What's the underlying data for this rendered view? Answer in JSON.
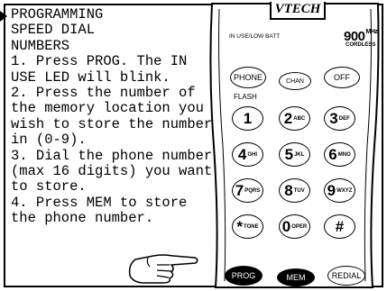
{
  "instructions": {
    "lines": [
      "PROGRAMMING",
      "SPEED DIAL",
      "NUMBERS",
      "1. Press PROG. The IN",
      "USE LED will blink.",
      "2. Press the number of",
      "the memory location you",
      "wish to store the number",
      "in (0-9).",
      "3. Dial the phone number",
      "(max 16 digits) you want",
      "to store.",
      "4. Press MEM to store",
      "the phone number."
    ]
  },
  "phone": {
    "brand": "VTECH",
    "in_use_label": "IN USE/LOW BATT",
    "frequency": "900",
    "frequency_unit": "MHz",
    "cordless": "CORDLESS",
    "flash_label": "FLASH",
    "buttons": {
      "phone": "PHONE",
      "chan": "CHAN",
      "off": "OFF",
      "prog": "PROG",
      "mem": "MEM",
      "redial": "REDIAL"
    },
    "keys": [
      {
        "num": "1",
        "letters": ""
      },
      {
        "num": "2",
        "letters": "ABC"
      },
      {
        "num": "3",
        "letters": "DEF"
      },
      {
        "num": "4",
        "letters": "GHI"
      },
      {
        "num": "5",
        "letters": "JKL"
      },
      {
        "num": "6",
        "letters": "MNO"
      },
      {
        "num": "7",
        "letters": "PQRS"
      },
      {
        "num": "8",
        "letters": "TUV"
      },
      {
        "num": "9",
        "letters": "WXYZ"
      },
      {
        "num": "*",
        "letters": "TONE"
      },
      {
        "num": "0",
        "letters": "OPER"
      },
      {
        "num": "#",
        "letters": ""
      }
    ]
  }
}
